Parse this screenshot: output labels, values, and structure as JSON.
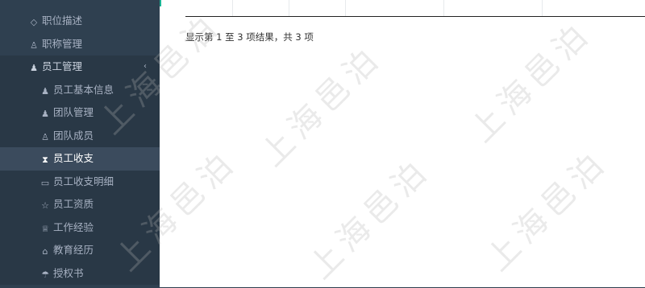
{
  "sidebar": {
    "items": [
      {
        "label": "职位描述",
        "icon": "diamond-icon",
        "glyph": "◇",
        "level": "top"
      },
      {
        "label": "职称管理",
        "icon": "user-group-icon",
        "glyph": "♙",
        "level": "top"
      },
      {
        "label": "员工管理",
        "icon": "user-lock-icon",
        "glyph": "♟",
        "level": "top",
        "expanded": true,
        "caret": "‹"
      },
      {
        "label": "员工基本信息",
        "icon": "user-icon",
        "glyph": "♟",
        "level": "sub"
      },
      {
        "label": "团队管理",
        "icon": "users-icon",
        "glyph": "♟",
        "level": "sub"
      },
      {
        "label": "团队成员",
        "icon": "user-outline-icon",
        "glyph": "♙",
        "level": "sub"
      },
      {
        "label": "员工收支",
        "icon": "hourglass-icon",
        "glyph": "⧗",
        "level": "sub",
        "active": true
      },
      {
        "label": "员工收支明细",
        "icon": "book-open-icon",
        "glyph": "▭",
        "level": "sub"
      },
      {
        "label": "员工资质",
        "icon": "star-outline-icon",
        "glyph": "☆",
        "level": "sub"
      },
      {
        "label": "工作经验",
        "icon": "trophy-icon",
        "glyph": "♕",
        "level": "sub"
      },
      {
        "label": "教育经历",
        "icon": "graduation-cap-icon",
        "glyph": "⌂",
        "level": "sub"
      },
      {
        "label": "授权书",
        "icon": "umbrella-icon",
        "glyph": "☂",
        "level": "sub"
      }
    ]
  },
  "content": {
    "pagination_info": "显示第 1 至 3 项结果，共 3 项"
  },
  "watermark": {
    "text": "上海邑泊"
  },
  "colors": {
    "sidebar_bg": "#2f4050",
    "sidebar_active_bg": "#3b4b5d",
    "accent": "#1ab394"
  }
}
